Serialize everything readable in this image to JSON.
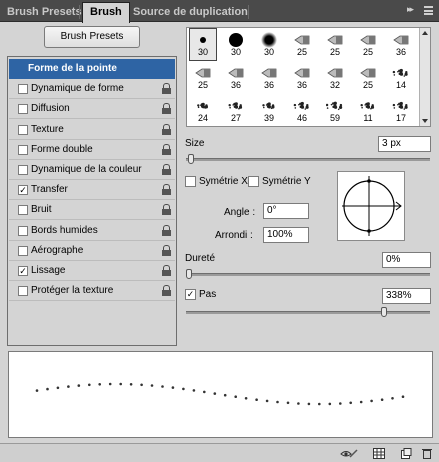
{
  "tabs": [
    {
      "label": "Brush Presets",
      "active": false
    },
    {
      "label": "Brush",
      "active": true
    },
    {
      "label": "Source de duplication",
      "active": false
    }
  ],
  "panel_menu_icon": "panel-menu-icon",
  "presets_button": "Brush Presets",
  "options": [
    {
      "label": "Forme de la pointe",
      "header": true,
      "checked": false,
      "locked": false
    },
    {
      "label": "Dynamique de forme",
      "checked": false,
      "locked": true
    },
    {
      "label": "Diffusion",
      "checked": false,
      "locked": true
    },
    {
      "label": "Texture",
      "checked": false,
      "locked": true
    },
    {
      "label": "Forme double",
      "checked": false,
      "locked": true
    },
    {
      "label": "Dynamique de la couleur",
      "checked": false,
      "locked": true
    },
    {
      "label": "Transfer",
      "checked": true,
      "locked": true
    },
    {
      "label": "Bruit",
      "checked": false,
      "locked": true
    },
    {
      "label": "Bords humides",
      "checked": false,
      "locked": true
    },
    {
      "label": "Aérographe",
      "checked": false,
      "locked": true
    },
    {
      "label": "Lissage",
      "checked": true,
      "locked": true
    },
    {
      "label": "Protéger la texture",
      "checked": false,
      "locked": true
    }
  ],
  "brush_tips": [
    {
      "size": "30",
      "kind": "hard",
      "selected": true
    },
    {
      "size": "30",
      "kind": "hard"
    },
    {
      "size": "30",
      "kind": "soft"
    },
    {
      "size": "25",
      "kind": "tip"
    },
    {
      "size": "25",
      "kind": "tip"
    },
    {
      "size": "25",
      "kind": "tip"
    },
    {
      "size": "36",
      "kind": "tip"
    },
    {
      "size": "25",
      "kind": "tip"
    },
    {
      "size": "36",
      "kind": "tip"
    },
    {
      "size": "36",
      "kind": "tip"
    },
    {
      "size": "36",
      "kind": "tip"
    },
    {
      "size": "32",
      "kind": "tip"
    },
    {
      "size": "25",
      "kind": "tip"
    },
    {
      "size": "14",
      "kind": "splat"
    },
    {
      "size": "24",
      "kind": "splat"
    },
    {
      "size": "27",
      "kind": "splat"
    },
    {
      "size": "39",
      "kind": "splat"
    },
    {
      "size": "46",
      "kind": "splat"
    },
    {
      "size": "59",
      "kind": "splat"
    },
    {
      "size": "11",
      "kind": "splat"
    },
    {
      "size": "17",
      "kind": "splat"
    }
  ],
  "size": {
    "label": "Size",
    "value": "3 px",
    "slider_fraction": 0.01
  },
  "flip_x": {
    "label": "Symétrie X",
    "checked": false
  },
  "flip_y": {
    "label": "Symétrie Y",
    "checked": false
  },
  "angle": {
    "label": "Angle :",
    "value": "0°"
  },
  "roundness": {
    "label": "Arrondi :",
    "value": "100%"
  },
  "hardness": {
    "label": "Dureté",
    "value": "0%",
    "slider_fraction": 0.0
  },
  "spacing": {
    "label": "Pas",
    "value": "338%",
    "checked": true,
    "slider_fraction": 0.82
  },
  "bottom_icons": [
    "eye-brush-icon",
    "grid-icon",
    "new-preset-icon",
    "trash-icon"
  ],
  "colors": {
    "accent": "#2e64a4",
    "panel": "#d4d4d4",
    "tabbar": "#4a4a4a"
  }
}
